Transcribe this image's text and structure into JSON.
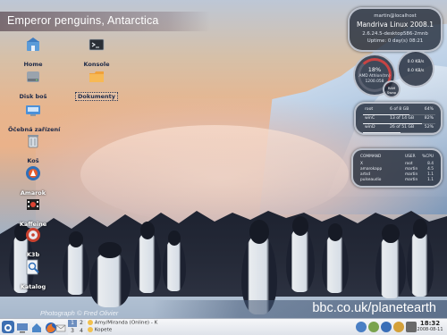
{
  "wallpaper": {
    "title": "Emperor penguins, Antarctica",
    "credit": "Photograph © Fred Olivier",
    "url": "bbc.co.uk/planetearth"
  },
  "desktop_icons": [
    {
      "label": "Home",
      "icon": "home-folder-icon"
    },
    {
      "label": "Disk boš",
      "icon": "hard-disk-icon"
    },
    {
      "label": "Öčebná zařízení",
      "icon": "storage-devices-icon"
    },
    {
      "label": "Koš",
      "icon": "trash-icon"
    },
    {
      "label": "Amarok",
      "icon": "amarok-icon"
    },
    {
      "label": "Kaffeine",
      "icon": "kaffeine-icon"
    },
    {
      "label": "K3b",
      "icon": "k3b-disc-icon"
    },
    {
      "label": "Katalog",
      "icon": "katalog-search-icon"
    },
    {
      "label": "Konsole",
      "icon": "terminal-icon"
    },
    {
      "label": "Dokumenty",
      "icon": "documents-folder-icon"
    }
  ],
  "sysinfo": {
    "user": "martin@localhost",
    "os": "Mandriva Linux 2008.1",
    "kernel": "2.6.24.5-desktop586-2mnb",
    "uptime": "Uptime:   0 day(s)  08:21"
  },
  "cpu_gauge": {
    "value": "18%",
    "model": "AMD Athlon(tm)",
    "freq": "1200.058"
  },
  "net_gauge": {
    "up": "0.0 KB/s",
    "down": "0.0 KB/s"
  },
  "ram_gauge": {
    "label": "RAM",
    "value": "Swap"
  },
  "disks": [
    {
      "name": "root",
      "usage": "6 of 8 GB",
      "percent": "64%",
      "fill": 0.64
    },
    {
      "name": "winC",
      "usage": "13 of 14 GB",
      "percent": "82%",
      "fill": 0.82
    },
    {
      "name": "winD",
      "usage": "26 of 51 GB",
      "percent": "52%",
      "fill": 0.52
    }
  ],
  "processes": {
    "headers": [
      "COMMAND",
      "USER",
      "%CPU"
    ],
    "rows": [
      [
        "X",
        "root",
        "8.4"
      ],
      [
        "amarokapp",
        "martin",
        "4.5"
      ],
      [
        "artsd",
        "martin",
        "1.1"
      ],
      [
        "pulseaudio",
        "martin",
        "1.1"
      ]
    ]
  },
  "taskbar": {
    "pager": [
      "1",
      "2",
      "3",
      "4"
    ],
    "tasks": [
      "Amy/Miranda (Online) - K",
      "Kopete"
    ],
    "time": "18:32",
    "date": "2008-08-11"
  },
  "colors": {
    "accent": "#6c8ebf",
    "cpu_ring": "#c84444",
    "widget_bg": "#1e2634"
  }
}
